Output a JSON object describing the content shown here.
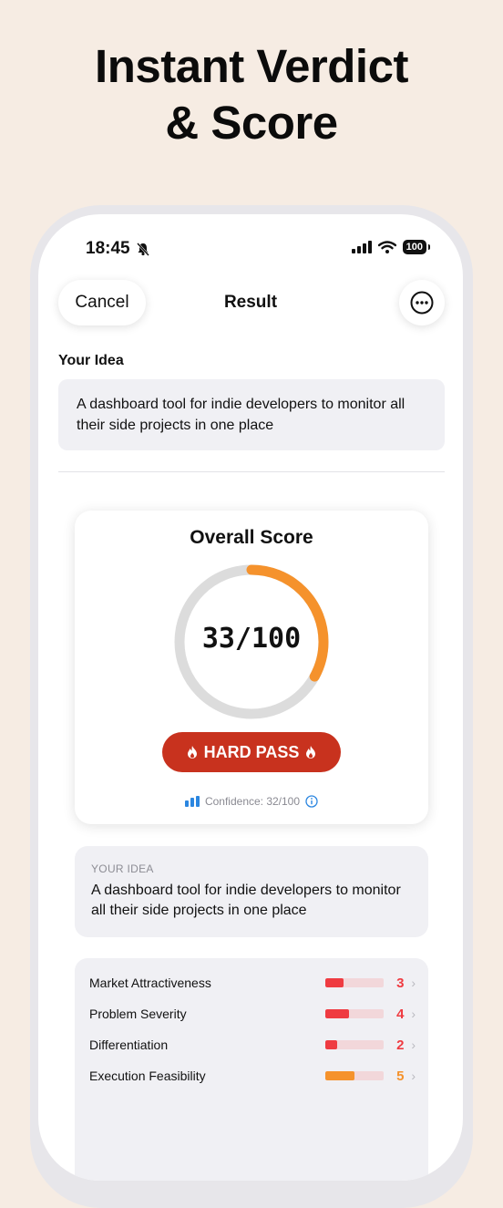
{
  "headline": {
    "line1": "Instant Verdict",
    "line2": "& Score"
  },
  "status": {
    "time": "18:45",
    "battery": "100"
  },
  "nav": {
    "cancel_label": "Cancel",
    "title": "Result",
    "more_icon": "ellipsis-circle-icon"
  },
  "idea_section": {
    "label": "Your Idea",
    "text": "A dashboard tool for indie developers to monitor all their side projects in one place"
  },
  "score_card": {
    "title": "Overall Score",
    "score_text": "33/100",
    "score": 33,
    "max": 100,
    "verdict": "HARD PASS",
    "verdict_icon": "flame-icon",
    "confidence_text": "Confidence: 32/100",
    "colors": {
      "ring": "#f5922c",
      "track": "#dcdcdc",
      "verdict_bg": "#c8321e"
    }
  },
  "idea_card": {
    "label": "YOUR IDEA",
    "text": "A dashboard tool for indie developers to monitor all their side projects in one place"
  },
  "metrics": [
    {
      "name": "Market Attractiveness",
      "score": 3,
      "score_text": "3",
      "max": 10,
      "color": "#ef3b41"
    },
    {
      "name": "Problem Severity",
      "score": 4,
      "score_text": "4",
      "max": 10,
      "color": "#ef3b41"
    },
    {
      "name": "Differentiation",
      "score": 2,
      "score_text": "2",
      "max": 10,
      "color": "#ef3b41"
    },
    {
      "name": "Execution Feasibility",
      "score": 5,
      "score_text": "5",
      "max": 10,
      "color": "#f5922c"
    }
  ]
}
